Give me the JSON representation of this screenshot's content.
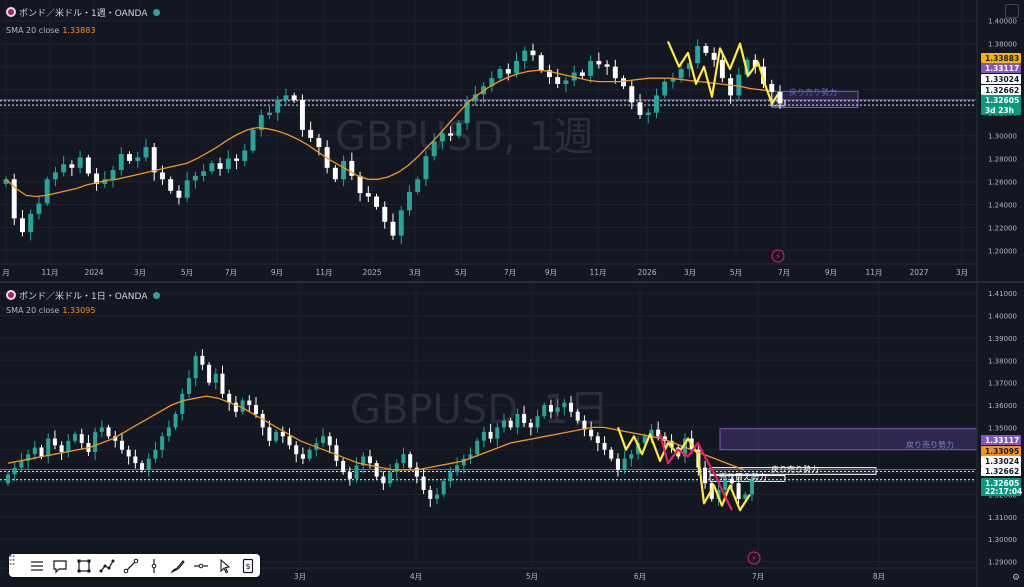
{
  "top": {
    "legend_title": "ポンド／米ドル・1週・OANDA",
    "sma_label": "SMA 20 close",
    "sma_value": "1.33883",
    "watermark": "GBPUSD, 1週",
    "price_ticks": [
      "1.40000",
      "1.38000",
      "1.36000",
      "1.34000",
      "1.32000",
      "1.30000",
      "1.28000",
      "1.26000",
      "1.24000",
      "1.22000",
      "1.20000"
    ],
    "time_ticks": [
      "月",
      "11月",
      "2024",
      "3月",
      "5月",
      "7月",
      "9月",
      "11月",
      "2025",
      "3月",
      "5月",
      "7月",
      "9月",
      "11月",
      "2026",
      "3月",
      "5月",
      "7月",
      "9月",
      "11月",
      "2027",
      "3月"
    ],
    "badges": [
      {
        "text": "1.33883",
        "bg": "#f7b500",
        "fg": "#131722"
      },
      {
        "text": "1.33117",
        "bg": "#7e57c2",
        "fg": "#ffffff"
      },
      {
        "text": "1.33024",
        "bg": "#ffffff",
        "fg": "#131722"
      },
      {
        "text": "1.32662",
        "bg": "#ffffff",
        "fg": "#131722"
      },
      {
        "text": "1.32605",
        "bg": "#089981",
        "fg": "#ffffff"
      },
      {
        "text": "3d 23h",
        "bg": "#089981",
        "fg": "#ffffff"
      }
    ],
    "zone_label": "戻り売り勢力"
  },
  "bottom": {
    "legend_title": "ポンド／米ドル・1日・OANDA",
    "sma_label": "SMA 20 close",
    "sma_value": "1.33095",
    "watermark": "GBPUSD, 1日",
    "price_ticks": [
      "1.41000",
      "1.40000",
      "1.39000",
      "1.38000",
      "1.37000",
      "1.36000",
      "1.35000",
      "1.34000",
      "1.33000",
      "1.32000",
      "1.31000",
      "1.30000",
      "1.29000"
    ],
    "time_ticks": [
      "3月",
      "4月",
      "5月",
      "6月",
      "7月",
      "8月"
    ],
    "badges": [
      {
        "text": "1.33117",
        "bg": "#7e57c2",
        "fg": "#ffffff"
      },
      {
        "text": "1.33095",
        "bg": "#f7931a",
        "fg": "#131722"
      },
      {
        "text": "1.33024",
        "bg": "#ffffff",
        "fg": "#131722"
      },
      {
        "text": "1.32662",
        "bg": "#ffffff",
        "fg": "#131722"
      },
      {
        "text": "1.32605",
        "bg": "#089981",
        "fg": "#ffffff"
      },
      {
        "text": "22:17:04",
        "bg": "#089981",
        "fg": "#ffffff"
      }
    ],
    "zone_labels": [
      "戻り売り勢力",
      "戻り売り勢力",
      "売り買え勢力"
    ]
  },
  "colors": {
    "up": "#26a69a",
    "down": "#ef5350",
    "sma": "#f7931a",
    "zigzag": "#ffeb3b",
    "zigzag_alt": "#e91e63",
    "zone": "#7e57c2"
  },
  "chart_data": [
    {
      "type": "candlestick",
      "title": "ポンド／米ドル・1週・OANDA",
      "timeframe": "1週",
      "ylim": [
        1.19,
        1.405
      ],
      "close": [
        1.262,
        1.228,
        1.216,
        1.232,
        1.241,
        1.262,
        1.268,
        1.275,
        1.272,
        1.281,
        1.267,
        1.258,
        1.262,
        1.27,
        1.284,
        1.278,
        1.281,
        1.29,
        1.268,
        1.262,
        1.252,
        1.246,
        1.261,
        1.265,
        1.269,
        1.276,
        1.271,
        1.28,
        1.278,
        1.287,
        1.305,
        1.318,
        1.32,
        1.331,
        1.335,
        1.331,
        1.305,
        1.298,
        1.29,
        1.272,
        1.262,
        1.278,
        1.265,
        1.25,
        1.247,
        1.238,
        1.225,
        1.213,
        1.235,
        1.251,
        1.262,
        1.282,
        1.295,
        1.302,
        1.3,
        1.311,
        1.33,
        1.336,
        1.343,
        1.35,
        1.358,
        1.354,
        1.365,
        1.374,
        1.37,
        1.357,
        1.351,
        1.345,
        1.348,
        1.355,
        1.352,
        1.365,
        1.362,
        1.36,
        1.35,
        1.343,
        1.329,
        1.318,
        1.32,
        1.335,
        1.347,
        1.35,
        1.358,
        1.363,
        1.378,
        1.372,
        1.366,
        1.35,
        1.335,
        1.353,
        1.366,
        1.36,
        1.345,
        1.338,
        1.328
      ],
      "sma20": [
        1.262,
        1.254,
        1.248,
        1.247,
        1.248,
        1.25,
        1.252,
        1.254,
        1.257,
        1.259,
        1.261,
        1.262,
        1.264,
        1.266,
        1.268,
        1.27,
        1.272,
        1.274,
        1.276,
        1.28,
        1.285,
        1.29,
        1.296,
        1.301,
        1.305,
        1.307,
        1.306,
        1.304,
        1.301,
        1.297,
        1.292,
        1.286,
        1.28,
        1.275,
        1.27,
        1.265,
        1.262,
        1.262,
        1.264,
        1.268,
        1.274,
        1.282,
        1.291,
        1.3,
        1.31,
        1.32,
        1.329,
        1.336,
        1.342,
        1.347,
        1.351,
        1.354,
        1.356,
        1.357,
        1.356,
        1.354,
        1.352,
        1.35,
        1.348,
        1.347,
        1.347,
        1.347,
        1.348,
        1.349,
        1.35,
        1.35,
        1.35,
        1.349,
        1.348,
        1.347,
        1.346,
        1.345,
        1.344,
        1.343,
        1.341,
        1.34,
        1.339
      ],
      "levels": [
        1.33117,
        1.33024,
        1.32662,
        1.32605
      ]
    },
    {
      "type": "candlestick",
      "title": "ポンド／米ドル・1日・OANDA",
      "timeframe": "1日",
      "ylim": [
        1.288,
        1.411
      ],
      "close": [
        1.329,
        1.332,
        1.335,
        1.338,
        1.341,
        1.337,
        1.345,
        1.342,
        1.339,
        1.344,
        1.347,
        1.343,
        1.339,
        1.348,
        1.35,
        1.346,
        1.344,
        1.34,
        1.337,
        1.334,
        1.331,
        1.336,
        1.34,
        1.346,
        1.35,
        1.356,
        1.365,
        1.372,
        1.382,
        1.378,
        1.37,
        1.374,
        1.365,
        1.361,
        1.357,
        1.362,
        1.36,
        1.356,
        1.35,
        1.344,
        1.348,
        1.346,
        1.342,
        1.338,
        1.336,
        1.34,
        1.343,
        1.346,
        1.342,
        1.335,
        1.33,
        1.327,
        1.333,
        1.337,
        1.334,
        1.328,
        1.325,
        1.33,
        1.334,
        1.338,
        1.332,
        1.328,
        1.322,
        1.318,
        1.32,
        1.326,
        1.33,
        1.333,
        1.336,
        1.338,
        1.344,
        1.348,
        1.345,
        1.35,
        1.353,
        1.35,
        1.356,
        1.352,
        1.35,
        1.355,
        1.36,
        1.357,
        1.359,
        1.361,
        1.357,
        1.353,
        1.349,
        1.346,
        1.343,
        1.34,
        1.336,
        1.331,
        1.336,
        1.338,
        1.343,
        1.346,
        1.349,
        1.346,
        1.344,
        1.341,
        1.337,
        1.345,
        1.34,
        1.332,
        1.325,
        1.318,
        1.322,
        1.327,
        1.325,
        1.318,
        1.32,
        1.327
      ],
      "sma20": [
        1.334,
        1.335,
        1.336,
        1.337,
        1.338,
        1.339,
        1.34,
        1.341,
        1.343,
        1.345,
        1.348,
        1.351,
        1.354,
        1.357,
        1.36,
        1.362,
        1.363,
        1.364,
        1.363,
        1.361,
        1.359,
        1.356,
        1.353,
        1.35,
        1.347,
        1.344,
        1.342,
        1.34,
        1.338,
        1.336,
        1.334,
        1.333,
        1.332,
        1.331,
        1.331,
        1.331,
        1.332,
        1.333,
        1.334,
        1.335,
        1.337,
        1.339,
        1.341,
        1.343,
        1.344,
        1.345,
        1.346,
        1.347,
        1.348,
        1.349,
        1.35,
        1.35,
        1.349,
        1.348,
        1.347,
        1.346,
        1.345,
        1.343,
        1.341,
        1.339,
        1.337,
        1.335,
        1.333,
        1.331
      ],
      "levels": [
        1.33117,
        1.33024,
        1.32662,
        1.32605
      ]
    }
  ]
}
